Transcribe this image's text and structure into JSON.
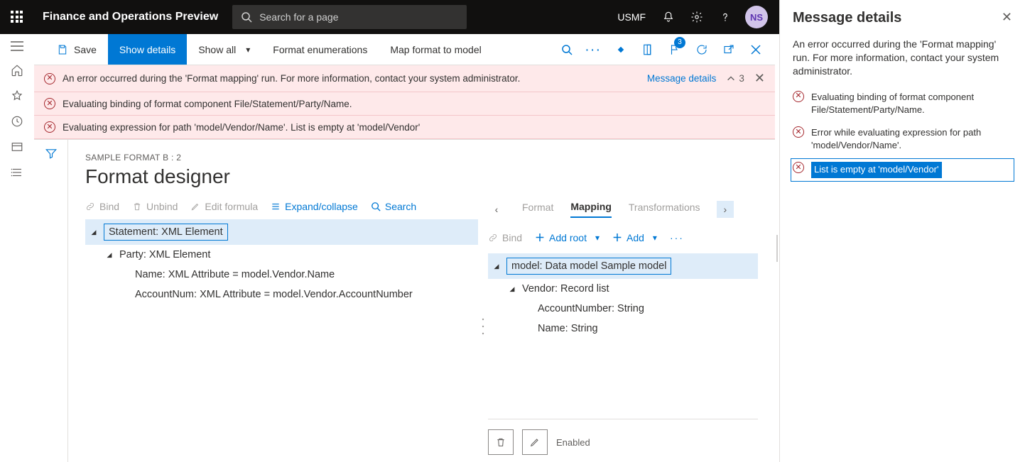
{
  "top": {
    "app_title": "Finance and Operations Preview",
    "search_placeholder": "Search for a page",
    "legal_entity": "USMF",
    "avatar_initials": "NS"
  },
  "commandBar": {
    "save": "Save",
    "showDetails": "Show details",
    "showAll": "Show all",
    "formatEnum": "Format enumerations",
    "mapFormat": "Map format to model",
    "noticeCount": "3"
  },
  "errors": {
    "rows": [
      "An error occurred during the 'Format mapping' run. For more information, contact your system administrator.",
      "Evaluating binding of format component File/Statement/Party/Name.",
      "Evaluating expression for path 'model/Vendor/Name'.   List is empty at 'model/Vendor'"
    ],
    "detailsLink": "Message details",
    "collapseCount": "3"
  },
  "designer": {
    "breadcrumb": "SAMPLE FORMAT B : 2",
    "title": "Format designer",
    "leftToolbar": {
      "bind": "Bind",
      "unbind": "Unbind",
      "edit": "Edit formula",
      "expand": "Expand/collapse",
      "search": "Search"
    },
    "leftTree": [
      {
        "indent": 0,
        "caret": true,
        "text": "Statement: XML Element",
        "box": true,
        "hl": true
      },
      {
        "indent": 1,
        "caret": true,
        "text": "Party: XML Element"
      },
      {
        "indent": 2,
        "caret": false,
        "text": "Name: XML Attribute = model.Vendor.Name"
      },
      {
        "indent": 2,
        "caret": false,
        "text": "AccountNum: XML Attribute = model.Vendor.AccountNumber"
      }
    ],
    "tabs": {
      "format": "Format",
      "mapping": "Mapping",
      "transform": "Transformations"
    },
    "rightToolbar": {
      "bind": "Bind",
      "addRoot": "Add root",
      "add": "Add"
    },
    "rightTree": [
      {
        "indent": 0,
        "caret": true,
        "text": "model: Data model Sample model",
        "box": true,
        "hl": true
      },
      {
        "indent": 1,
        "caret": true,
        "text": "Vendor: Record list"
      },
      {
        "indent": 2,
        "caret": false,
        "text": "AccountNumber: String"
      },
      {
        "indent": 2,
        "caret": false,
        "text": "Name: String"
      }
    ],
    "enabledLabel": "Enabled"
  },
  "detailsPanel": {
    "title": "Message details",
    "summary": "An error occurred during the 'Format mapping' run. For more information, contact your system administrator.",
    "items": [
      {
        "text": "Evaluating binding of format component File/Statement/Party/Name.",
        "selected": false
      },
      {
        "text": "Error while evaluating expression for path 'model/Vendor/Name'.",
        "selected": false
      },
      {
        "text": "List is empty at 'model/Vendor'",
        "selected": true
      }
    ]
  }
}
